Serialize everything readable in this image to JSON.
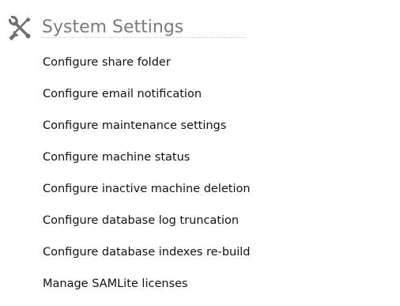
{
  "section": {
    "title": "System Settings",
    "icon": "tools-icon"
  },
  "links": [
    {
      "label": "Configure share folder"
    },
    {
      "label": "Configure email notification"
    },
    {
      "label": "Configure maintenance settings"
    },
    {
      "label": "Configure machine status"
    },
    {
      "label": "Configure inactive machine deletion"
    },
    {
      "label": "Configure database log truncation"
    },
    {
      "label": "Configure database indexes re-build"
    },
    {
      "label": "Manage SAMLite licenses"
    }
  ],
  "colors": {
    "title": "#7a7a7a",
    "link": "#111111",
    "rule": "#c8c8c8",
    "icon": "#6e6e6e"
  }
}
